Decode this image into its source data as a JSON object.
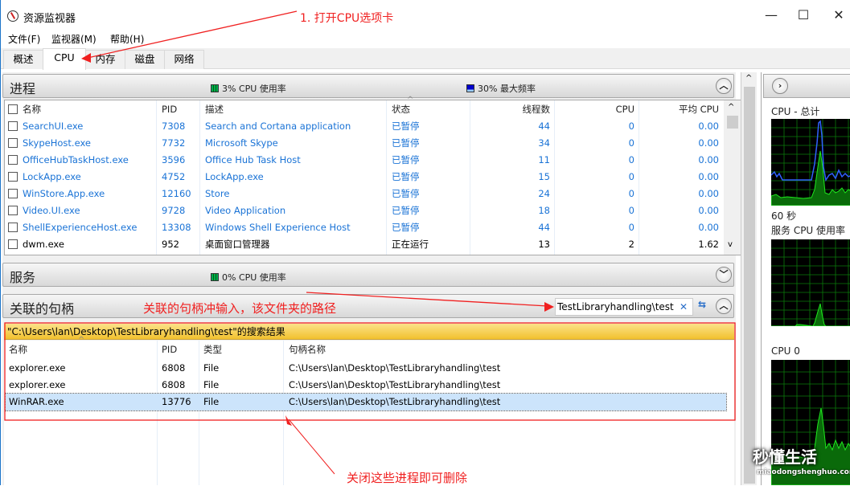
{
  "window": {
    "title": "资源监视器",
    "controls": {
      "minimize": "—",
      "maximize": "☐",
      "close": "✕"
    }
  },
  "menu": [
    "文件(F)",
    "监视器(M)",
    "帮助(H)"
  ],
  "tabs": [
    {
      "label": "概述",
      "active": false
    },
    {
      "label": "CPU",
      "active": true
    },
    {
      "label": "内存",
      "active": false
    },
    {
      "label": "磁盘",
      "active": false
    },
    {
      "label": "网络",
      "active": false
    }
  ],
  "annotations": {
    "open_cpu_tab": "1. 打开CPU选项卡",
    "handles_input": "关联的句柄冲输入，该文件夹的路径",
    "close_processes": "关闭这些进程即可删除",
    "color": "#f02020"
  },
  "processes": {
    "title": "进程",
    "cpu_usage": "3% CPU 使用率",
    "max_freq": "30% 最大频率",
    "columns": [
      "名称",
      "PID",
      "描述",
      "状态",
      "线程数",
      "CPU",
      "平均 CPU"
    ],
    "rows": [
      {
        "name": "SearchUI.exe",
        "pid": "7308",
        "desc": "Search and Cortana application",
        "status": "已暂停",
        "threads": "44",
        "cpu": "0",
        "avg_cpu": "0.00",
        "suspended": true
      },
      {
        "name": "SkypeHost.exe",
        "pid": "7732",
        "desc": "Microsoft Skype",
        "status": "已暂停",
        "threads": "34",
        "cpu": "0",
        "avg_cpu": "0.00",
        "suspended": true
      },
      {
        "name": "OfficeHubTaskHost.exe",
        "pid": "3596",
        "desc": "Office Hub Task Host",
        "status": "已暂停",
        "threads": "11",
        "cpu": "0",
        "avg_cpu": "0.00",
        "suspended": true
      },
      {
        "name": "LockApp.exe",
        "pid": "4752",
        "desc": "LockApp.exe",
        "status": "已暂停",
        "threads": "15",
        "cpu": "0",
        "avg_cpu": "0.00",
        "suspended": true
      },
      {
        "name": "WinStore.App.exe",
        "pid": "12160",
        "desc": "Store",
        "status": "已暂停",
        "threads": "24",
        "cpu": "0",
        "avg_cpu": "0.00",
        "suspended": true
      },
      {
        "name": "Video.UI.exe",
        "pid": "9728",
        "desc": "Video Application",
        "status": "已暂停",
        "threads": "18",
        "cpu": "0",
        "avg_cpu": "0.00",
        "suspended": true
      },
      {
        "name": "ShellExperienceHost.exe",
        "pid": "13308",
        "desc": "Windows Shell Experience Host",
        "status": "已暂停",
        "threads": "44",
        "cpu": "0",
        "avg_cpu": "0.00",
        "suspended": true
      },
      {
        "name": "dwm.exe",
        "pid": "952",
        "desc": "桌面窗口管理器",
        "status": "正在运行",
        "threads": "13",
        "cpu": "2",
        "avg_cpu": "1.62",
        "suspended": false
      }
    ]
  },
  "services": {
    "title": "服务",
    "cpu_usage": "0% CPU 使用率"
  },
  "handles": {
    "title": "关联的句柄",
    "search_value": "TestLibraryhandling\\test",
    "clear_icon": "✕",
    "result_banner": "\"C:\\Users\\lan\\Desktop\\TestLibraryhandling\\test\"的搜索结果",
    "columns": [
      "名称",
      "PID",
      "类型",
      "句柄名称"
    ],
    "rows": [
      {
        "name": "explorer.exe",
        "pid": "6808",
        "type": "File",
        "handle": "C:\\Users\\lan\\Desktop\\TestLibraryhandling\\test",
        "selected": false
      },
      {
        "name": "explorer.exe",
        "pid": "6808",
        "type": "File",
        "handle": "C:\\Users\\lan\\Desktop\\TestLibraryhandling\\test",
        "selected": false
      },
      {
        "name": "WinRAR.exe",
        "pid": "13776",
        "type": "File",
        "handle": "C:\\Users\\lan\\Desktop\\TestLibraryhandling\\test",
        "selected": true
      }
    ]
  },
  "graphs": {
    "cpu_total_label": "CPU - 总计",
    "time_label": "60 秒",
    "service_cpu_label": "服务 CPU 使用率",
    "cpu0_label": "CPU 0"
  },
  "watermark": {
    "text": "秒懂生活",
    "url": "miaodongshenghuo.com"
  },
  "colors": {
    "link_blue": "#1a73d6",
    "banner_yellow": "#f5c842",
    "selection": "#cce4fb",
    "graph_green": "#00d000",
    "graph_blue": "#3060ff"
  }
}
